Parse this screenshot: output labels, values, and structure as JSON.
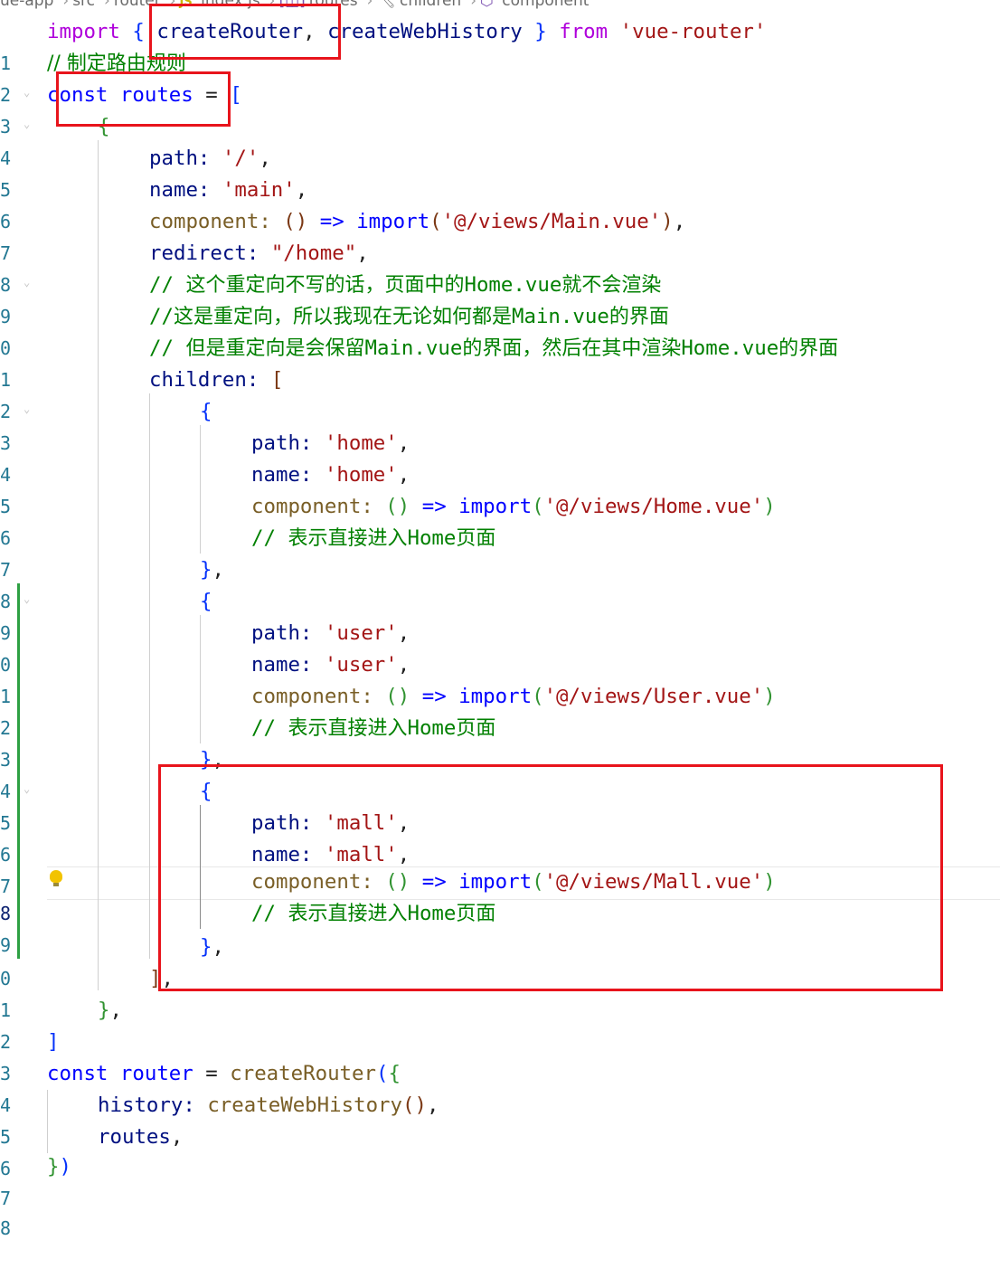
{
  "breadcrumb": [
    "ue-app",
    "src",
    "router",
    "index.js",
    "routes",
    "children",
    "component"
  ],
  "breadcrumb_icons": {
    "file": "js-file-icon",
    "routes": "variable-icon",
    "children": "property-icon",
    "component": "method-icon"
  },
  "gutter": {
    "line_numbers": [
      "1",
      "2",
      "3",
      "4",
      "5",
      "6",
      "7",
      "8",
      "9",
      "0",
      "1",
      "2",
      "3",
      "4",
      "5",
      "6",
      "7",
      "8",
      "9",
      "0",
      "1",
      "2",
      "3",
      "4",
      "5",
      "6",
      "7",
      "8",
      "9",
      "0",
      "1",
      "2",
      "3",
      "4",
      "5",
      "6",
      "7",
      "8"
    ]
  },
  "code": {
    "l1": {
      "import": "import",
      "open": "{",
      "create_router": "createRouter",
      "comma": ",",
      "create_web_history": "createWebHistory",
      "close": "}",
      "from": "from",
      "module": "'vue-router'"
    },
    "l2": {
      "comment": "// 制定路由规则"
    },
    "l3": {
      "const": "const",
      "name": "routes",
      "eq": " = ",
      "bracket": "["
    },
    "l4": {
      "brace": "{"
    },
    "l5": {
      "key": "path:",
      "val": "'/'",
      "punct": ","
    },
    "l6": {
      "key": "name:",
      "val": "'main'",
      "punct": ","
    },
    "l7": {
      "key": "component:",
      "parens": "()",
      "arrow": "=>",
      "import": "import",
      "open": "(",
      "path": "'@/views/Main.vue'",
      "close": ")",
      "punct": ","
    },
    "l8": {
      "key": "redirect:",
      "val": "\"/home\"",
      "punct": ","
    },
    "l9": {
      "prefix": "// ",
      "cn1": "这个重定向不写的话，页面中的",
      "code": "Home.vue",
      "cn2": "就不会渲染"
    },
    "l10": {
      "prefix": "//",
      "cn1": "这是重定向，所以我现在无论如何都是",
      "code": "Main.vue",
      "cn2": "的界面"
    },
    "l11": {
      "prefix": "// ",
      "cn1": "但是重定向是会保留",
      "code1": "Main.vue",
      "cn2": "的界面，然后在其中渲染",
      "code2": "Home.vue",
      "cn3": "的界面"
    },
    "l12": {
      "key": "children:",
      "bracket": "["
    },
    "l13": {
      "brace": "{"
    },
    "l14": {
      "key": "path:",
      "val": "'home'",
      "punct": ","
    },
    "l15": {
      "key": "name:",
      "val": "'home'",
      "punct": ","
    },
    "l16": {
      "key": "component:",
      "parens": "()",
      "arrow": "=>",
      "import": "import",
      "open": "(",
      "path": "'@/views/Home.vue'",
      "close": ")"
    },
    "l17": {
      "prefix": "// ",
      "cn1": "表示直接进入",
      "code": "Home",
      "cn2": "页面"
    },
    "l18": {
      "brace": "}",
      "punct": ","
    },
    "l19": {
      "brace": "{"
    },
    "l20": {
      "key": "path:",
      "val": "'user'",
      "punct": ","
    },
    "l21": {
      "key": "name:",
      "val": "'user'",
      "punct": ","
    },
    "l22": {
      "key": "component:",
      "parens": "()",
      "arrow": "=>",
      "import": "import",
      "open": "(",
      "path": "'@/views/User.vue'",
      "close": ")"
    },
    "l23": {
      "prefix": "// ",
      "cn1": "表示直接进入",
      "code": "Home",
      "cn2": "页面"
    },
    "l24": {
      "brace": "}",
      "punct": ","
    },
    "l25": {
      "brace": "{"
    },
    "l26": {
      "key": "path:",
      "val": "'mall'",
      "punct": ","
    },
    "l27": {
      "key": "name:",
      "val": "'mall'",
      "punct": ","
    },
    "l28": {
      "key": "component:",
      "parens": "()",
      "arrow": "=>",
      "import": "import",
      "open": "(",
      "path": "'@/views/Mall.vue'",
      "close": ")"
    },
    "l29": {
      "prefix": "// ",
      "cn1": "表示直接进入",
      "code": "Home",
      "cn2": "页面"
    },
    "l30": {
      "brace": "}",
      "punct": ","
    },
    "l31": {
      "bracket": "]",
      "punct": ","
    },
    "l32": {
      "brace": "}",
      "punct": ","
    },
    "l33": {
      "bracket": "]"
    },
    "l34": {
      "const": "const",
      "name": "router",
      "eq": " = ",
      "fn": "createRouter",
      "open": "(",
      "brace": "{"
    },
    "l35": {
      "key": "history:",
      "fn": "createWebHistory",
      "parens": "()",
      "punct": ","
    },
    "l36": {
      "val": "routes",
      "punct": ","
    },
    "l37": {
      "brace": "}",
      "close": ")"
    }
  },
  "colors": {
    "keyword_import": "#af00db",
    "keyword_const": "#0000ff",
    "string": "#a31515",
    "comment": "#008000",
    "function": "#795e26",
    "variable": "#001080",
    "bracket_level1": "#0431fa",
    "bracket_level2": "#319331",
    "bracket_level3": "#7b3814",
    "line_number": "#237893",
    "annotation_box": "#e8141c",
    "git_added": "#2ea043"
  },
  "editor": {
    "active_line": "28",
    "lightbulb_icon": "lightbulb-icon"
  }
}
